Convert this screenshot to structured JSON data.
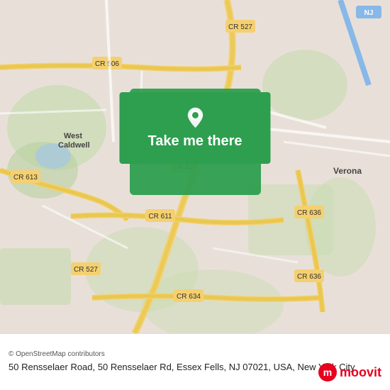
{
  "map": {
    "alt": "Map showing 50 Rensselaer Road area, Essex Fells, NJ"
  },
  "cta": {
    "button_label": "Take me there",
    "pin_icon": "📍"
  },
  "footer": {
    "osm_credit": "© OpenStreetMap contributors",
    "address": "50 Rensselaer Road, 50 Rensselaer Rd, Essex Fells, NJ 07021, USA, New York City"
  },
  "branding": {
    "logo_text": "moovit",
    "logo_icon": "m"
  },
  "colors": {
    "cta_green": "#2e9e4f",
    "moovit_red": "#e8001e",
    "map_bg": "#e8e0d8"
  }
}
